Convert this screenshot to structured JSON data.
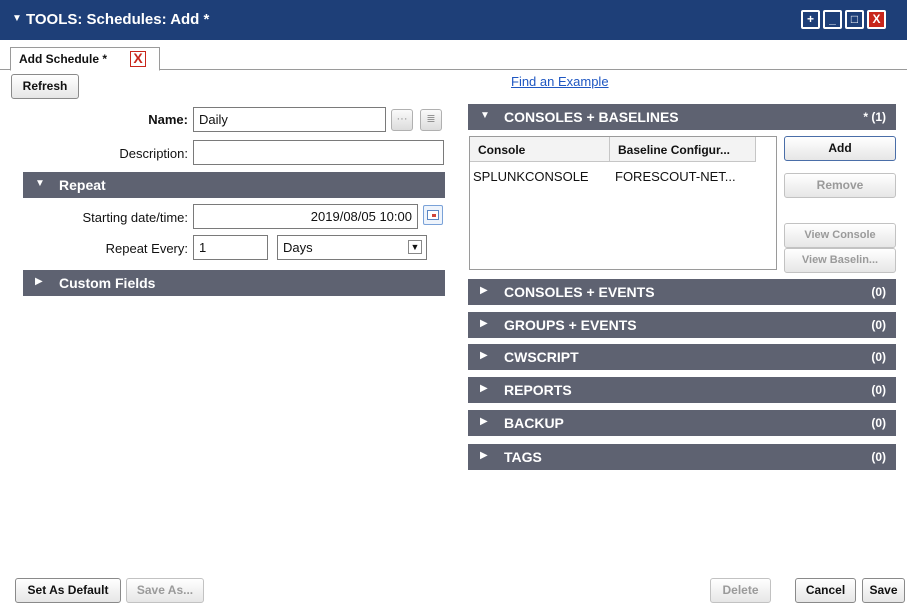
{
  "window": {
    "title": "TOOLS: Schedules: Add *",
    "buttons": [
      "+",
      "_",
      "□",
      "X"
    ]
  },
  "tab": {
    "label": "Add Schedule *",
    "close": "X"
  },
  "toolbar": {
    "refresh": "Refresh",
    "find_example": "Find an Example"
  },
  "form": {
    "name_label": "Name:",
    "name_value": "Daily",
    "description_label": "Description:",
    "description_value": "",
    "repeat_section": "Repeat",
    "starting_label": "Starting date/time:",
    "starting_value": "2019/08/05 10:00",
    "repeat_every_label": "Repeat Every:",
    "repeat_every_value": "1",
    "repeat_unit": "Days",
    "custom_fields_section": "Custom Fields"
  },
  "consoles_baselines": {
    "title": "CONSOLES + BASELINES",
    "count": "* (1)",
    "columns": [
      "Console",
      "Baseline Configur..."
    ],
    "rows": [
      [
        "SPLUNKCONSOLE",
        "FORESCOUT-NET..."
      ]
    ],
    "buttons": {
      "add": "Add",
      "remove": "Remove",
      "view_console": "View Console",
      "view_baseline": "View Baselin..."
    }
  },
  "sections": [
    {
      "title": "CONSOLES + EVENTS",
      "count": "(0)"
    },
    {
      "title": "GROUPS + EVENTS",
      "count": "(0)"
    },
    {
      "title": "CWSCRIPT",
      "count": "(0)"
    },
    {
      "title": "REPORTS",
      "count": "(0)"
    },
    {
      "title": "BACKUP",
      "count": "(0)"
    },
    {
      "title": "TAGS",
      "count": "(0)"
    }
  ],
  "footer": {
    "set_default": "Set As Default",
    "save_as": "Save As...",
    "delete": "Delete",
    "cancel": "Cancel",
    "save": "Save"
  },
  "colors": {
    "titlebar": "#1e3f78",
    "section": "#5e6271",
    "close_red": "#c8261b",
    "link": "#1f57c2"
  }
}
